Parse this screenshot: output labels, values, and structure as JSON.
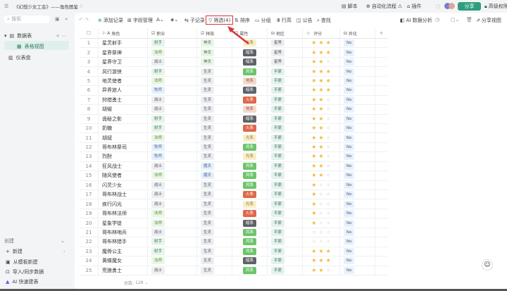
{
  "header": {
    "title": "《幻想少女工会》——角色图鉴",
    "script": "脚本",
    "automation": "自动化流程",
    "plugin": "插件",
    "share": "分享",
    "advanced_perm": "高级权限"
  },
  "sidebar": {
    "search_placeholder": "搜索",
    "table_group": "数据表",
    "view": "表格视图",
    "dashboard": "仪表盘",
    "create_heading": "创建",
    "new": "新建",
    "from_template": "从模板新建",
    "import": "导入/同步数据",
    "ai_build": "AI 快速建表"
  },
  "toolbar": {
    "add_record": "添加记录",
    "field_mgmt": "字段管理",
    "sub_record": "子记录",
    "filter": "筛选(4)",
    "sort": "排序",
    "group": "分组",
    "row_height": "行高",
    "notice": "公告",
    "find": "查找",
    "ai_analysis": "AI 数据分析",
    "share_view": "分享视图"
  },
  "columns": [
    "角色",
    "职业",
    "种族",
    "属性",
    "地区",
    "评分",
    "异化"
  ],
  "footer": {
    "count_label": "总数:",
    "count": "128"
  },
  "colors": {
    "accent": "#2f9e7e",
    "filter_box": "#d9363e",
    "star": "#f0b93a"
  },
  "rows": [
    [
      "星灵射手",
      "射手",
      "神灵",
      "光系",
      "星界",
      3,
      "No"
    ],
    [
      "星界祭神",
      "法师",
      "神灵",
      "暗系",
      "星界",
      3,
      "No"
    ],
    [
      "星界守卫",
      "战士",
      "神灵",
      "暗系",
      "星界",
      2,
      "No"
    ],
    [
      "风行游侠",
      "射手",
      "生灵",
      "风系",
      "平原",
      3,
      "No"
    ],
    [
      "地灵使者",
      "法师",
      "生灵",
      "地系",
      "平原",
      3,
      "No"
    ],
    [
      "异界旅人",
      "牧师",
      "生灵",
      "暗系",
      "平原",
      3,
      "No"
    ],
    [
      "狩猎勇士",
      "战士",
      "生灵",
      "火系",
      "平原",
      2,
      "No"
    ],
    [
      "胡椒",
      "战士",
      "生灵",
      "地系",
      "平原",
      2,
      "No"
    ],
    [
      "诡秘之影",
      "射手",
      "生灵",
      "暗系",
      "平原",
      2,
      "No"
    ],
    [
      "奶糖",
      "射手",
      "生灵",
      "火系",
      "平原",
      2,
      "No"
    ],
    [
      "胡斌",
      "法师",
      "生灵",
      "光系",
      "平原",
      2,
      "No"
    ],
    [
      "哥布林祭司",
      "牧师",
      "生灵",
      "风系",
      "平原",
      2,
      "No"
    ],
    [
      "烈酎",
      "牧师",
      "生灵",
      "光系",
      "平原",
      2,
      "No"
    ],
    [
      "狂风战士",
      "战士",
      "魔灵",
      "风系",
      "平原",
      2,
      "No"
    ],
    [
      "随风使者",
      "法师",
      "魔灵",
      "风系",
      "平原",
      2,
      "No"
    ],
    [
      "闪灵少女",
      "战士",
      "生灵",
      "风系",
      "平原",
      1,
      "No"
    ],
    [
      "哥布林战士",
      "战士",
      "生灵",
      "火系",
      "平原",
      1,
      "No"
    ],
    [
      "疾行闪光",
      "战士",
      "生灵",
      "光系",
      "平原",
      1,
      "No"
    ],
    [
      "哥布林法师",
      "法师",
      "生灵",
      "火系",
      "平原",
      1,
      "No"
    ],
    [
      "星象学徒",
      "法师",
      "生灵",
      "暗系",
      "平原",
      1,
      "No"
    ],
    [
      "哥布林哨兵",
      "战士",
      "生灵",
      "风系",
      "平原",
      0,
      "No"
    ],
    [
      "哥布林猎手",
      "射手",
      "生灵",
      "风系",
      "平原",
      0,
      "No"
    ],
    [
      "魔骨公主",
      "射手",
      "生灵",
      "风系",
      "平原",
      3,
      "No"
    ],
    [
      "黄蝶魔女",
      "法师",
      "生灵",
      "暗系",
      "平原",
      3,
      "No"
    ],
    [
      "荒狼勇士",
      "战士",
      "生灵",
      "风系",
      "平原",
      2,
      "No"
    ]
  ]
}
